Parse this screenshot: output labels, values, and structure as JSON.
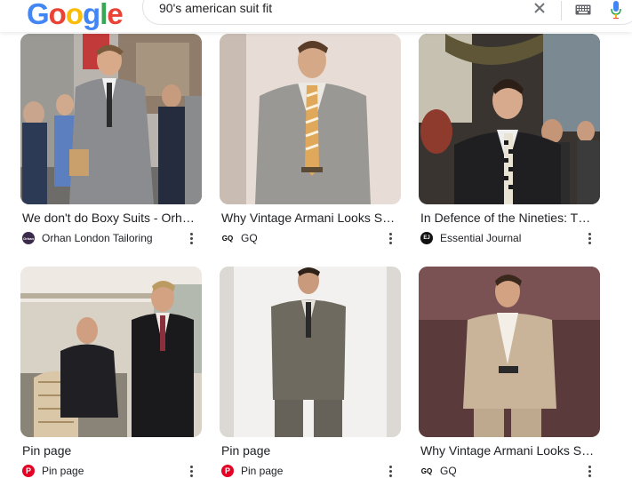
{
  "logo": {
    "letters": [
      {
        "ch": "G",
        "color": "#4285F4"
      },
      {
        "ch": "o",
        "color": "#EA4335"
      },
      {
        "ch": "o",
        "color": "#FBBC05"
      },
      {
        "ch": "g",
        "color": "#4285F4"
      },
      {
        "ch": "l",
        "color": "#34A853"
      },
      {
        "ch": "e",
        "color": "#EA4335"
      }
    ]
  },
  "search": {
    "query": "90's american suit fit"
  },
  "results": [
    {
      "title": "We don't do Boxy Suits - Orhan London Tailoring",
      "source": "Orhan London Tailoring",
      "favicon": "orhan-favicon",
      "favicon_color": "#3b2a4a",
      "favicon_text": "Orhan"
    },
    {
      "title": "Why Vintage Armani Looks So Good",
      "source": "GQ",
      "favicon": "gq-favicon",
      "favicon_color": "#ffffff",
      "favicon_text": "GQ"
    },
    {
      "title": "In Defence of the Nineties: The Best Suits",
      "source": "Essential Journal",
      "favicon": "ej-favicon",
      "favicon_color": "#111111",
      "favicon_text": "EJ"
    },
    {
      "title": "Pin page",
      "source": "Pin page",
      "favicon": "pinterest-favicon",
      "favicon_color": "#e60023",
      "favicon_text": "P"
    },
    {
      "title": "Pin page",
      "source": "Pin page",
      "favicon": "pinterest-favicon",
      "favicon_color": "#e60023",
      "favicon_text": "P"
    },
    {
      "title": "Why Vintage Armani Looks So Good",
      "source": "GQ",
      "favicon": "gq-favicon",
      "favicon_color": "#ffffff",
      "favicon_text": "GQ"
    }
  ]
}
